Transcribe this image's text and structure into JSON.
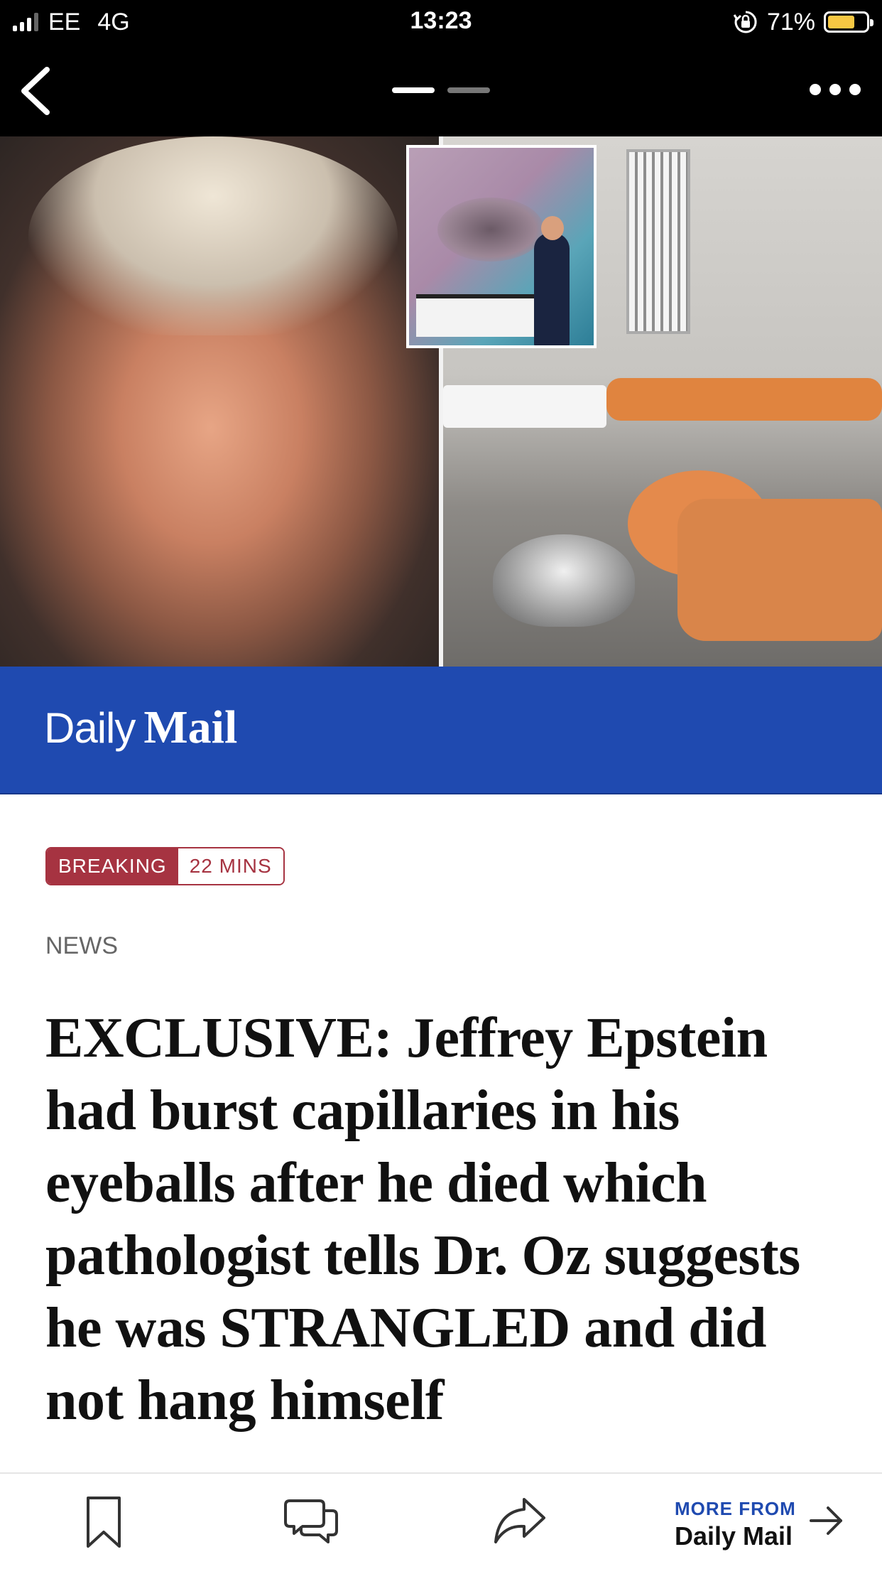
{
  "status_bar": {
    "carrier": "EE",
    "network": "4G",
    "time": "13:23",
    "battery_percent": "71%",
    "battery_level": 0.71,
    "signal_bars_active": 3,
    "icons": [
      "signal-icon",
      "rotation-lock-icon",
      "battery-icon"
    ]
  },
  "nav": {
    "icons": [
      "back-icon",
      "more-icon"
    ],
    "page_count": 2,
    "active_page": 1
  },
  "hero": {
    "alt_description_visible": false
  },
  "brand": {
    "daily": "Daily",
    "mail": "Mail",
    "color": "#1f4ab0"
  },
  "article": {
    "badge_breaking": "BREAKING",
    "badge_time": "22 MINS",
    "section": "NEWS",
    "headline": "EXCLUSIVE: Jeffrey Epstein had burst capillaries in his eyeballs after he died which pathologist tells Dr. Oz suggests he was STRANGLED and did not hang himself",
    "badge_color": "#a63341"
  },
  "toolbar": {
    "icons": [
      "bookmark-icon",
      "comment-icon",
      "share-icon",
      "arrow-right-icon"
    ],
    "more_from_label": "MORE FROM",
    "more_from_name": "Daily Mail"
  }
}
